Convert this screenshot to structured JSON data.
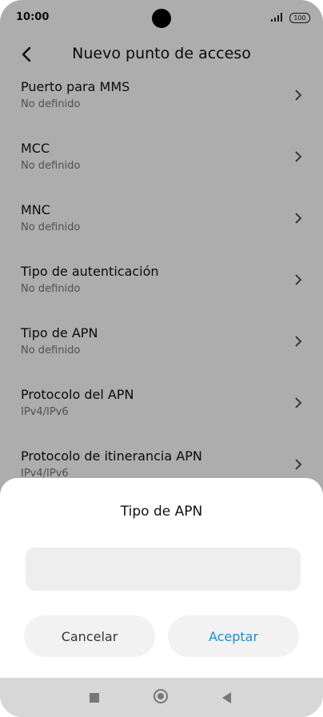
{
  "status": {
    "time": "10:00",
    "battery": "100"
  },
  "appbar": {
    "title": "Nuevo punto de acceso"
  },
  "settings": [
    {
      "label": "Puerto para MMS",
      "value": "No definido"
    },
    {
      "label": "MCC",
      "value": "No definido"
    },
    {
      "label": "MNC",
      "value": "No definido"
    },
    {
      "label": "Tipo de autenticación",
      "value": "No definido"
    },
    {
      "label": "Tipo de APN",
      "value": "No definido"
    },
    {
      "label": "Protocolo del APN",
      "value": "IPv4/IPv6"
    },
    {
      "label": "Protocolo de itinerancia APN",
      "value": "IPv4/IPv6"
    }
  ],
  "dialog": {
    "title": "Tipo de APN",
    "input_value": "",
    "cancel_label": "Cancelar",
    "ok_label": "Aceptar"
  },
  "colors": {
    "accent": "#1a8fd6"
  }
}
